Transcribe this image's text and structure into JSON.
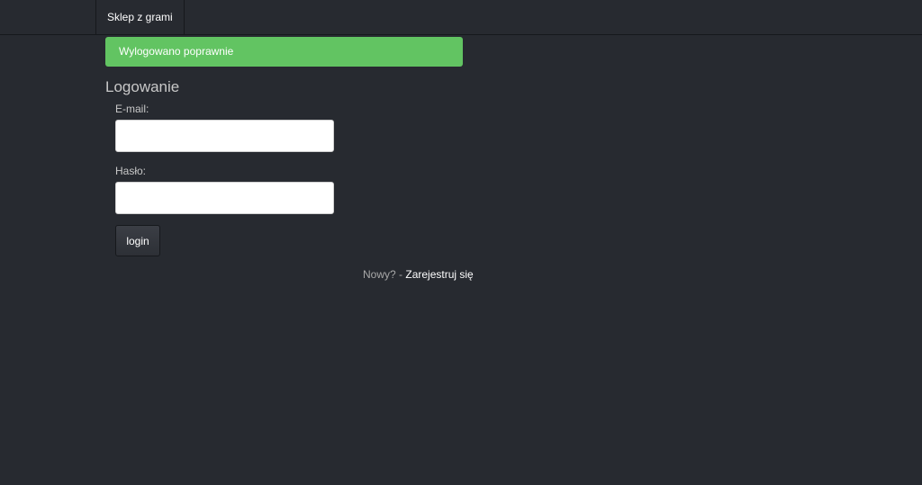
{
  "navbar": {
    "brand": "Sklep z grami"
  },
  "alert": {
    "message": "Wylogowano poprawnie",
    "color": "#62c462"
  },
  "login_form": {
    "title": "Logowanie",
    "email_label": "E-mail:",
    "email_value": "",
    "password_label": "Hasło:",
    "password_value": "",
    "submit_label": "login"
  },
  "register": {
    "prompt": "Nowy? -",
    "link_text": "Zarejestruj się"
  },
  "colors": {
    "background": "#272a30",
    "text": "#c8c8c8",
    "success": "#62c462"
  }
}
